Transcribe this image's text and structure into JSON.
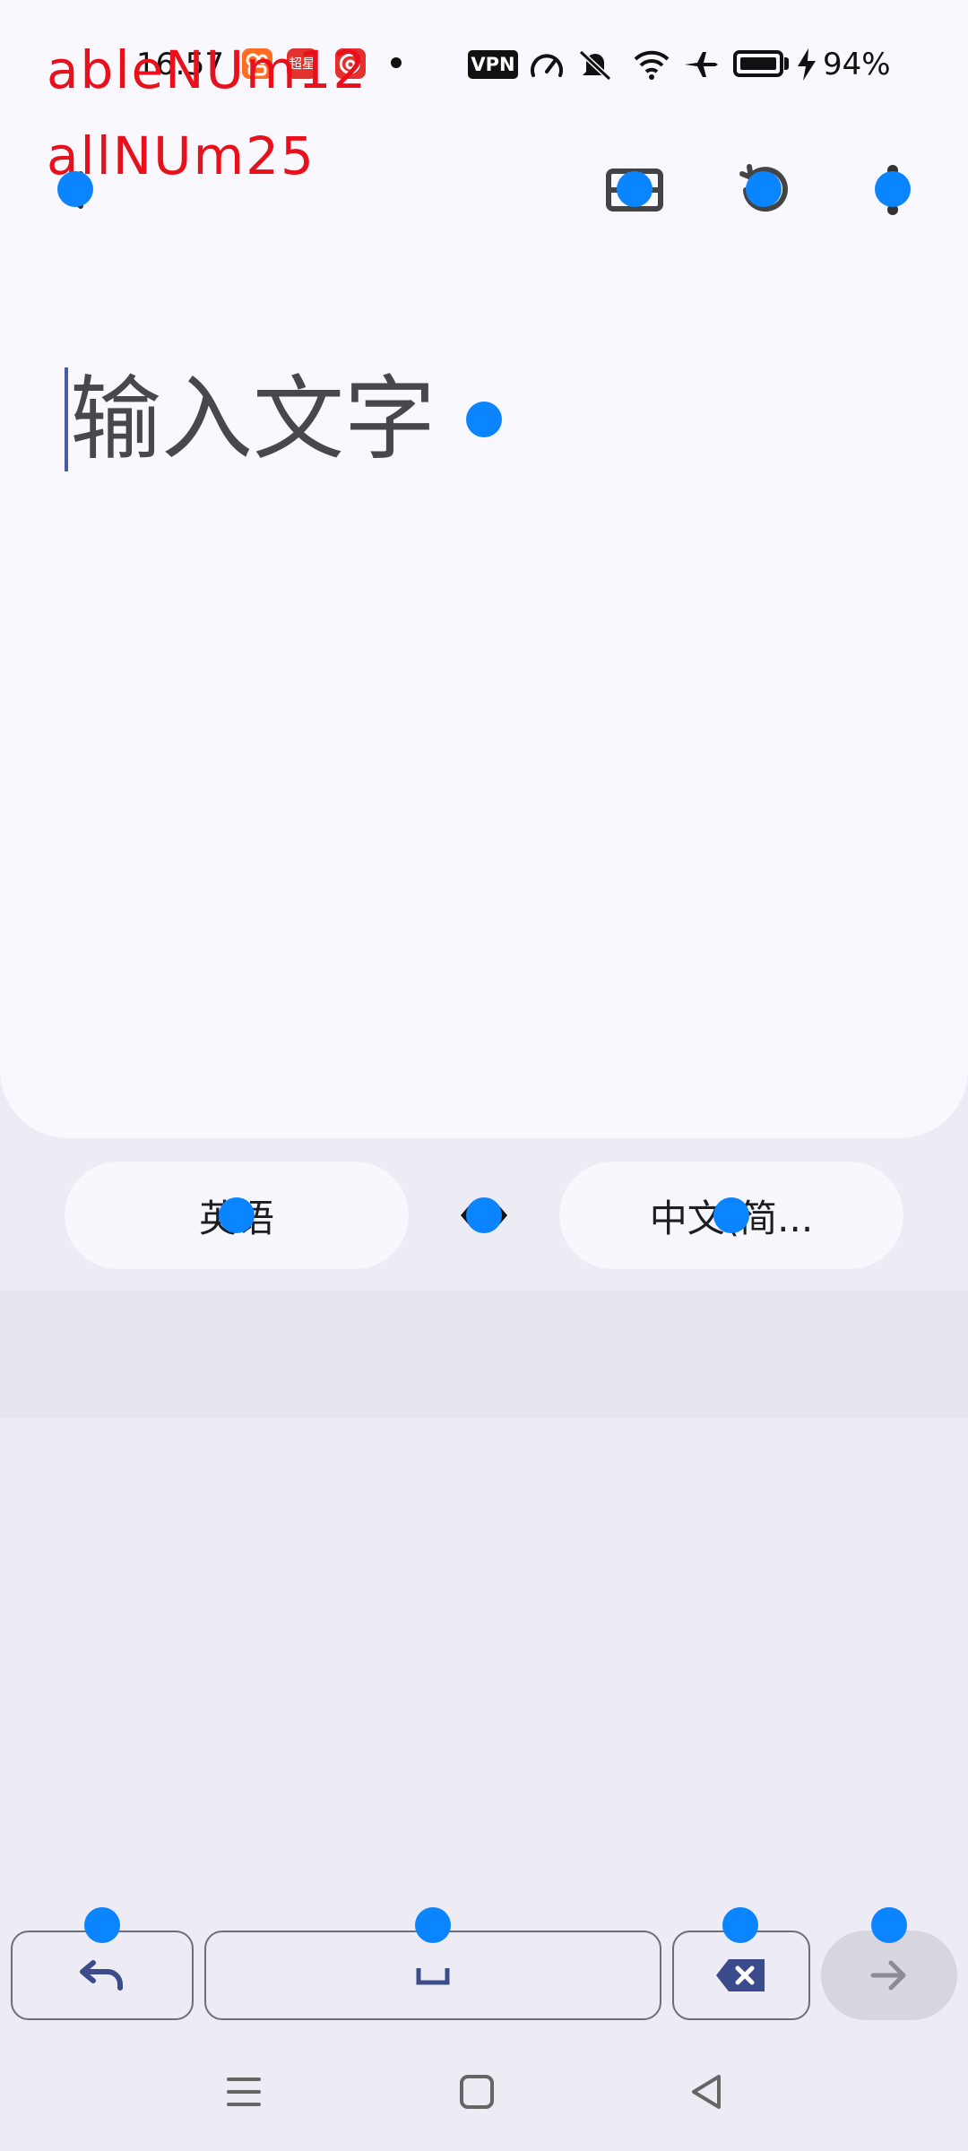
{
  "status_bar": {
    "time": "16:57",
    "app_icons": [
      "kuaishou-icon",
      "chaoxing-icon",
      "netease-music-icon"
    ],
    "chaoxing_label": "超星",
    "vpn_label": "VPN",
    "icons": [
      "speed-icon",
      "mute-icon",
      "wifi-icon",
      "airplane-icon",
      "battery-icon",
      "charging-icon"
    ],
    "battery_percent": "94%"
  },
  "overlay": {
    "line1": "ableNUm12",
    "line2": "allNUm25",
    "color": "#e8101a"
  },
  "toolbar": {
    "icons": [
      "back-icon",
      "scan-icon",
      "history-icon",
      "more-icon"
    ]
  },
  "input": {
    "placeholder": "输入文字"
  },
  "language_bar": {
    "source": "英语",
    "target": "中文(简...",
    "swap_icon": "swap-icon"
  },
  "keys": {
    "undo_icon": "undo-icon",
    "space_icon": "space-icon",
    "delete_icon": "backspace-icon",
    "next_icon": "arrow-right-icon"
  },
  "nav_bar": {
    "icons": [
      "menu-icon",
      "home-icon",
      "back-triangle-icon"
    ]
  },
  "colors": {
    "card_background": "#f8f8fe",
    "page_background": "#edecf5",
    "suggestion_band": "#e7e5ef",
    "caret": "#4a5aa6",
    "touch_marker": "#0a84ff",
    "next_key": "#d8d7e0"
  }
}
